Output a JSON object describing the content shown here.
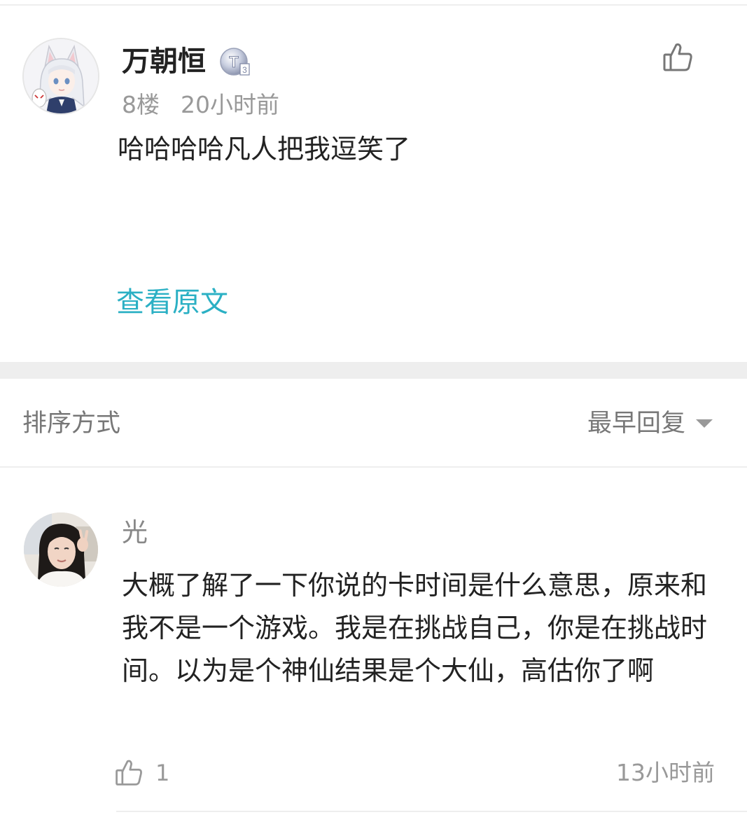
{
  "post": {
    "username": "万朝恒",
    "level_badge": "T3",
    "floor": "8楼",
    "time": "20小时前",
    "text": "哈哈哈哈凡人把我逗笑了",
    "view_original": "查看原文",
    "icons": {
      "avatar": "anime-avatar",
      "like": "thumbs-up-icon"
    }
  },
  "sort": {
    "label": "排序方式",
    "value": "最早回复",
    "icon": "chevron-down-icon"
  },
  "reply": {
    "username": "光",
    "text": "大概了解了一下你说的卡时间是什么意思，原来和我不是一个游戏。我是在挑战自己，你是在挑战时间。以为是个神仙结果是个大仙，高估你了啊",
    "like_count": "1",
    "time": "13小时前",
    "icons": {
      "avatar": "user-photo-avatar",
      "like": "thumbs-up-icon"
    }
  },
  "colors": {
    "accent": "#2bb0c4",
    "text_primary": "#222222",
    "text_secondary": "#999999",
    "divider": "#eeeeee"
  }
}
